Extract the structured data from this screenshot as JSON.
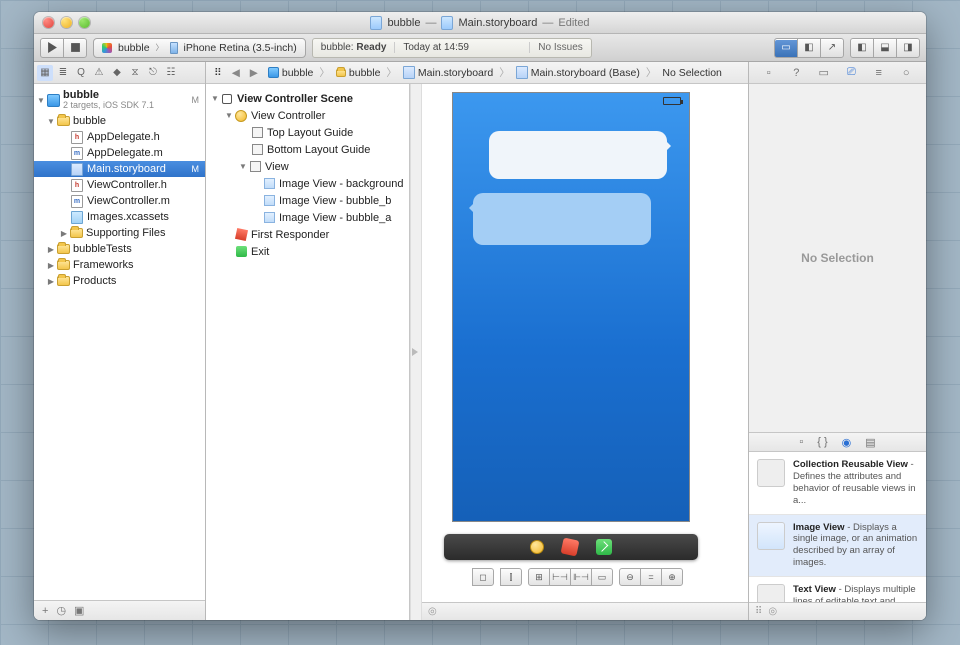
{
  "window": {
    "doc1": "bubble",
    "doc2": "Main.storyboard",
    "edited": "Edited"
  },
  "toolbar": {
    "scheme_target": "bubble",
    "scheme_device": "iPhone Retina (3.5-inch)",
    "status_app": "bubble:",
    "status_state": "Ready",
    "status_time": "Today at 14:59",
    "status_issues": "No Issues"
  },
  "navigator": {
    "project": "bubble",
    "project_sub": "2 targets, iOS SDK 7.1",
    "badge_m": "M",
    "tree": {
      "root": "bubble",
      "files": [
        "AppDelegate.h",
        "AppDelegate.m",
        "Main.storyboard",
        "ViewController.h",
        "ViewController.m",
        "Images.xcassets"
      ],
      "supporting": "Supporting Files",
      "groups": [
        "bubbleTests",
        "Frameworks",
        "Products"
      ]
    }
  },
  "jump": {
    "items": [
      "bubble",
      "bubble",
      "Main.storyboard",
      "Main.storyboard (Base)",
      "No Selection"
    ]
  },
  "outline": {
    "scene": "View Controller Scene",
    "vc": "View Controller",
    "top_guide": "Top Layout Guide",
    "bottom_guide": "Bottom Layout Guide",
    "view": "View",
    "img_bg": "Image View - background",
    "img_b": "Image View - bubble_b",
    "img_a": "Image View - bubble_a",
    "first_responder": "First Responder",
    "exit": "Exit"
  },
  "inspector": {
    "empty": "No Selection",
    "lib": [
      {
        "title": "Collection Reusable View",
        "body": " - Defines the attributes and behavior of reusable views in a..."
      },
      {
        "title": "Image View",
        "body": " - Displays a single image, or an animation described by an array of images."
      },
      {
        "title": "Text View",
        "body": " - Displays multiple lines of editable text and sends an action message to a target..."
      }
    ]
  }
}
